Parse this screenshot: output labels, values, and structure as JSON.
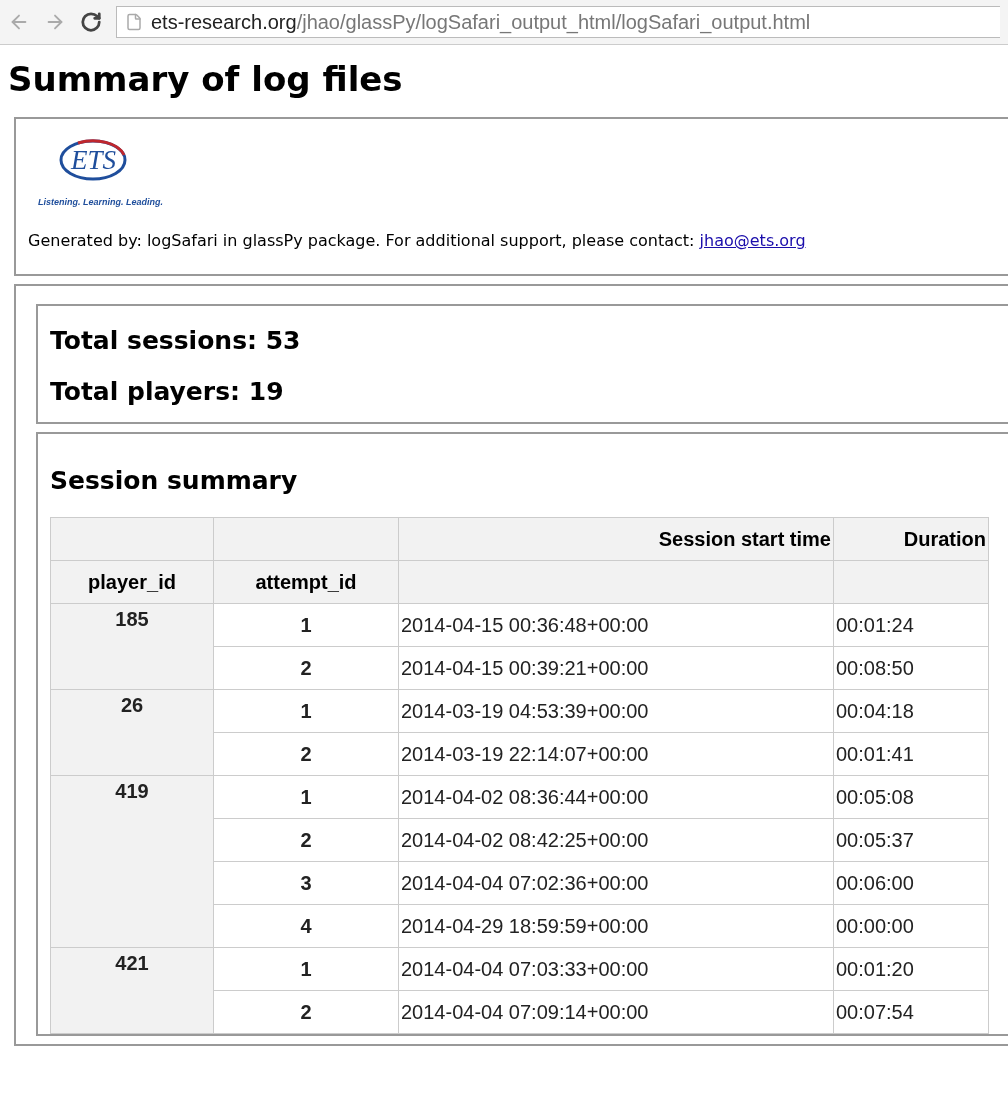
{
  "browser": {
    "url_host": "ets-research.org",
    "url_path": "/jhao/glassPy/logSafari_output_html/logSafari_output.html"
  },
  "title": "Summary of log files",
  "header": {
    "logo": "ETS",
    "tagline": "Listening. Learning. Leading.",
    "generated_text": "Generated by: logSafari in glassPy package. For additional support, please contact: ",
    "contact_link": "jhao@ets.org"
  },
  "totals": [
    "Total sessions: 53",
    "Total players: 19"
  ],
  "session_summary": {
    "heading": "Session summary",
    "upper_headers": [
      "Session start time",
      "Duration"
    ],
    "lower_headers": [
      "player_id",
      "attempt_id"
    ],
    "groups": [
      {
        "player_id": "185",
        "rows": [
          {
            "attempt_id": "1",
            "start": "2014-04-15 00:36:48+00:00",
            "duration": "00:01:24"
          },
          {
            "attempt_id": "2",
            "start": "2014-04-15 00:39:21+00:00",
            "duration": "00:08:50"
          }
        ]
      },
      {
        "player_id": "26",
        "rows": [
          {
            "attempt_id": "1",
            "start": "2014-03-19 04:53:39+00:00",
            "duration": "00:04:18"
          },
          {
            "attempt_id": "2",
            "start": "2014-03-19 22:14:07+00:00",
            "duration": "00:01:41"
          }
        ]
      },
      {
        "player_id": "419",
        "rows": [
          {
            "attempt_id": "1",
            "start": "2014-04-02 08:36:44+00:00",
            "duration": "00:05:08"
          },
          {
            "attempt_id": "2",
            "start": "2014-04-02 08:42:25+00:00",
            "duration": "00:05:37"
          },
          {
            "attempt_id": "3",
            "start": "2014-04-04 07:02:36+00:00",
            "duration": "00:06:00"
          },
          {
            "attempt_id": "4",
            "start": "2014-04-29 18:59:59+00:00",
            "duration": "00:00:00"
          }
        ]
      },
      {
        "player_id": "421",
        "rows": [
          {
            "attempt_id": "1",
            "start": "2014-04-04 07:03:33+00:00",
            "duration": "00:01:20"
          },
          {
            "attempt_id": "2",
            "start": "2014-04-04 07:09:14+00:00",
            "duration": "00:07:54"
          }
        ]
      }
    ]
  }
}
